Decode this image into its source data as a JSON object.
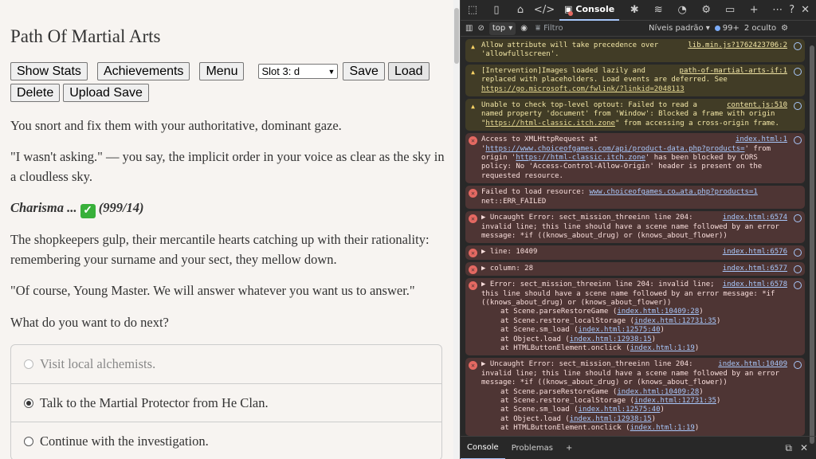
{
  "game": {
    "title": "Path Of Martial Arts",
    "buttons": {
      "show_stats": "Show Stats",
      "achievements": "Achievements",
      "menu": "Menu",
      "save": "Save",
      "load": "Load",
      "delete": "Delete",
      "upload_save": "Upload Save"
    },
    "slot_select": "Slot 3: d",
    "paragraphs": [
      "You snort and fix them with your authoritative, dominant gaze.",
      "\"I wasn't asking.\" — you say, the implicit order in your voice as clear as the sky in a cloudless sky.",
      "The shopkeepers gulp, their mercantile hearts catching up with their rationality: remembering your surname and your sect, they mellow down.",
      "\"Of course, Young Master. We will answer whatever you want us to answer.\"",
      "What do you want to do next?"
    ],
    "check": {
      "label": "Charisma ...",
      "result": "(999/14)"
    },
    "choices": [
      {
        "label": "Visit local alchemists.",
        "state": "disabled"
      },
      {
        "label": "Talk to the Martial Protector from He Clan.",
        "state": "selected"
      },
      {
        "label": "Continue with the investigation.",
        "state": "unselected"
      }
    ]
  },
  "devtools": {
    "tabs": {
      "console": "Console"
    },
    "toolbar": {
      "context": "top",
      "filter_placeholder": "Filtro",
      "levels": "Níveis padrão",
      "issues_count": "99+",
      "hidden": "2 oculto"
    },
    "drawer": {
      "console": "Console",
      "problems": "Problemas"
    },
    "messages": [
      {
        "type": "w",
        "src": "lib.min.js?1762423706:2",
        "text": "Allow attribute will take precedence over 'allowfullscreen'."
      },
      {
        "type": "w",
        "src": "path-of-martial-arts-if:1",
        "pre": "[Intervention]Images loaded lazily and replaced with placeholders. Load events are deferred. See ",
        "link": "https://go.microsoft.com/fwlink/?linkid=2048113",
        "post": ""
      },
      {
        "type": "w",
        "src": "content.js:510",
        "pre": "Unable to check top-level optout: Failed to read a named property 'document' from 'Window': Blocked a frame with origin \"",
        "link": "https://html-classic.itch.zone",
        "post": "\" from accessing a cross-origin frame."
      },
      {
        "type": "e",
        "src": "index.html:1",
        "pre": "Access to XMLHttpRequest at '",
        "link": "https://www.choiceofgames.com/api/product-data.php?products=",
        "mid": "' from origin '",
        "link2": "https://html-classic.itch.zone",
        "post": "' has been blocked by CORS policy: No 'Access-Control-Allow-Origin' header is present on the requested resource."
      },
      {
        "type": "e",
        "src": "",
        "pre": "Failed to load resource: ",
        "link": "www.choiceofgames.co…ata.php?products=1",
        "post": "\nnet::ERR_FAILED"
      },
      {
        "type": "e",
        "src": "index.html:6574",
        "text": "▶ Uncaught Error: sect_mission_threeinn line 204: invalid line; this line should have a scene name followed by an error message: *if ((knows_about_drug) or (knows_about_flower))"
      },
      {
        "type": "e",
        "src": "index.html:6576",
        "text": "▶ line: 10409"
      },
      {
        "type": "e",
        "src": "index.html:6577",
        "text": "▶ column: 28"
      },
      {
        "type": "e",
        "src": "index.html:6578",
        "text": "▶ Error: sect_mission_threeinn line 204: invalid line; this line should have a scene name followed by an error message: *if ((knows_about_drug) or (knows_about_flower))",
        "stack": [
          {
            "fn": "at Scene.parseRestoreGame (",
            "loc": "index.html:10409:28"
          },
          {
            "fn": "at Scene.restore_localStorage (",
            "loc": "index.html:12731:35"
          },
          {
            "fn": "at Scene.sm_load (",
            "loc": "index.html:12575:40"
          },
          {
            "fn": "at Object.load (",
            "loc": "index.html:12938:15"
          },
          {
            "fn": "at HTMLButtonElement.onclick (",
            "loc": "index.html:1:19"
          }
        ]
      },
      {
        "type": "e",
        "src": "index.html:10409",
        "text": "▶ Uncaught Error: sect_mission_threeinn line 204: invalid line; this line should have a scene name followed by an error message: *if ((knows_about_drug) or (knows_about_flower))",
        "stack": [
          {
            "fn": "at Scene.parseRestoreGame (",
            "loc": "index.html:10409:28"
          },
          {
            "fn": "at Scene.restore_localStorage (",
            "loc": "index.html:12731:35"
          },
          {
            "fn": "at Scene.sm_load (",
            "loc": "index.html:12575:40"
          },
          {
            "fn": "at Object.load (",
            "loc": "index.html:12938:15"
          },
          {
            "fn": "at HTMLButtonElement.onclick (",
            "loc": "index.html:1:19"
          }
        ]
      }
    ]
  }
}
